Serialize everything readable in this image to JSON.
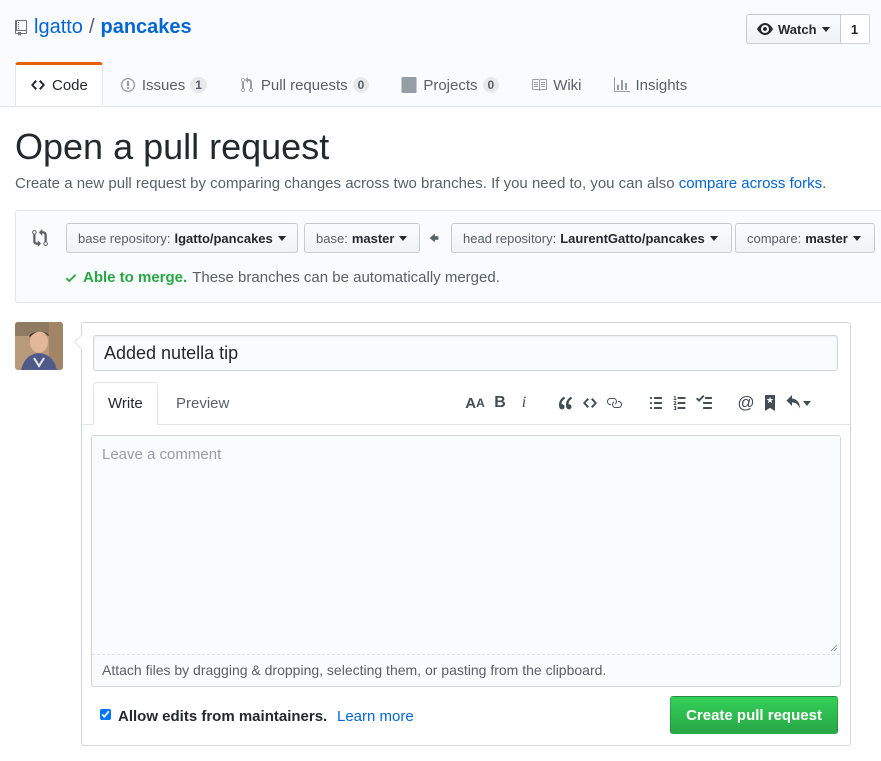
{
  "repo": {
    "owner": "lgatto",
    "separator": "/",
    "name": "pancakes"
  },
  "watch": {
    "label": "Watch",
    "count": "1"
  },
  "tabs": [
    {
      "label": "Code",
      "icon": "code-icon"
    },
    {
      "label": "Issues",
      "icon": "issue-icon",
      "count": "1"
    },
    {
      "label": "Pull requests",
      "icon": "pull-request-icon",
      "count": "0"
    },
    {
      "label": "Projects",
      "icon": "project-icon",
      "count": "0"
    },
    {
      "label": "Wiki",
      "icon": "book-icon"
    },
    {
      "label": "Insights",
      "icon": "graph-icon"
    }
  ],
  "page": {
    "title": "Open a pull request",
    "subtitle": "Create a new pull request by comparing changes across two branches. If you need to, you can also",
    "subtitle_link": "compare across forks",
    "subtitle_end": "."
  },
  "range": {
    "base_repo_label": "base repository:",
    "base_repo_value": "lgatto/pancakes",
    "base_label": "base:",
    "base_value": "master",
    "head_repo_label": "head repository:",
    "head_repo_value": "LaurentGatto/pancakes",
    "compare_label": "compare:",
    "compare_value": "master",
    "merge_ok": "Able to merge.",
    "merge_text": "These branches can be automatically merged."
  },
  "form": {
    "title_value": "Added nutella tip",
    "tab_write": "Write",
    "tab_preview": "Preview",
    "comment_placeholder": "Leave a comment",
    "attach_text": "Attach files by dragging & dropping, selecting them, or pasting from the clipboard.",
    "allow_edits_label": "Allow edits from maintainers.",
    "learn_more": "Learn more",
    "submit_label": "Create pull request"
  },
  "colors": {
    "accent": "#0366d6",
    "success": "#28a745",
    "tab_active": "#e36209"
  }
}
